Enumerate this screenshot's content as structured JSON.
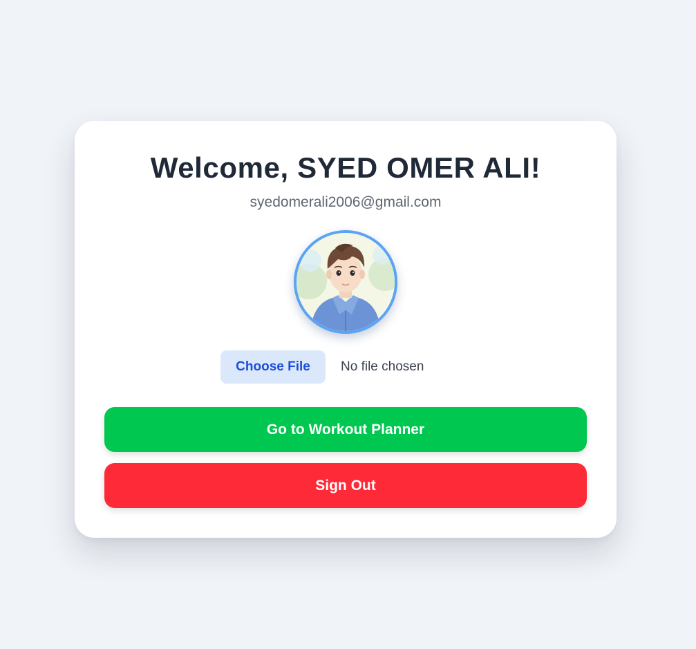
{
  "profile": {
    "welcome_title": "Welcome, SYED OMER ALI!",
    "email": "syedomerali2006@gmail.com",
    "avatar_icon": "profile-avatar-illustration"
  },
  "file_upload": {
    "button_label": "Choose File",
    "status_text": "No file chosen"
  },
  "actions": {
    "workout_planner_label": "Go to Workout Planner",
    "sign_out_label": "Sign Out"
  },
  "colors": {
    "background": "#f0f3f8",
    "title_text": "#1f2937",
    "avatar_border": "#5ba3f5",
    "choose_file_bg": "#dbe8fb",
    "choose_file_text": "#1d4ed8",
    "workout_button": "#00c74f",
    "sign_out_button": "#fe2a37"
  }
}
